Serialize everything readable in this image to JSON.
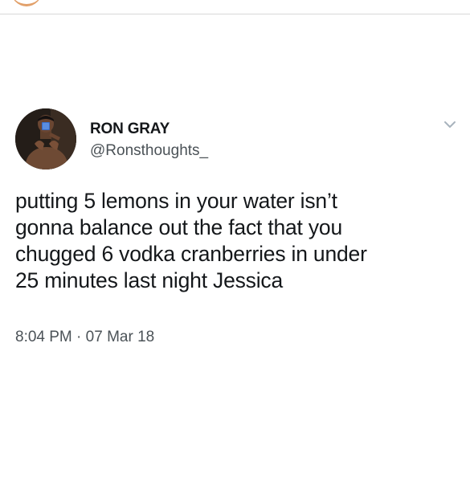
{
  "tweet": {
    "display_name": "RON GRAY",
    "handle": "@Ronsthoughts_",
    "text_lines": [
      "putting 5 lemons in your water isn’t",
      "gonna balance out the fact that you",
      "chugged 6 vodka cranberries in under",
      "25 minutes last night Jessica"
    ],
    "time": "8:04 PM",
    "separator": "·",
    "date": "07 Mar 18"
  },
  "icons": {
    "avatar": "profile-photo",
    "menu": "chevron-down-icon"
  },
  "colors": {
    "name": "#14171a",
    "secondary": "#4b5257",
    "divider": "#d8d8d8",
    "caret": "#a8b3bd",
    "top_avatar_ring": "#e2a06a"
  }
}
